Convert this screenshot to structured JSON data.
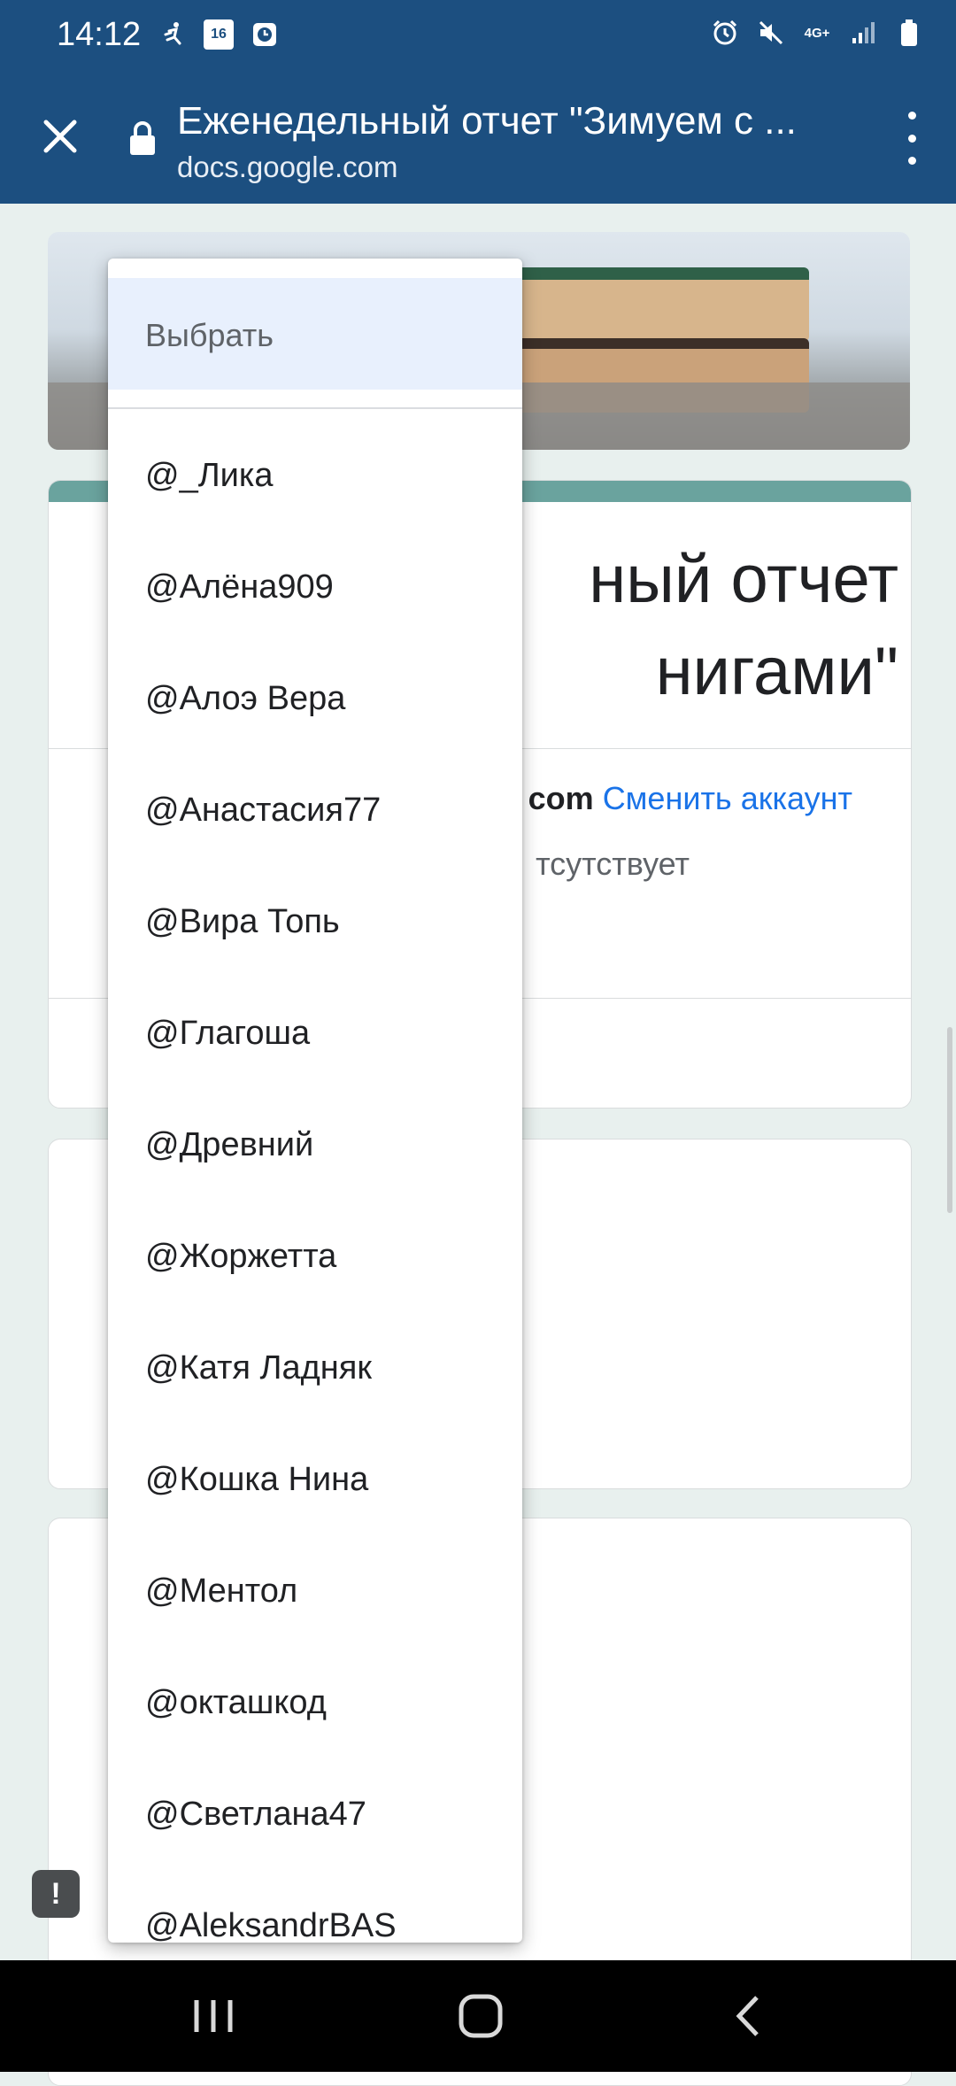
{
  "status_bar": {
    "time": "14:12",
    "left_icons": [
      "running-icon",
      "calendar-icon",
      "clock-app-icon"
    ],
    "calendar_day": "16",
    "right_icons": [
      "alarm-icon",
      "mute-icon",
      "network-4g-icon",
      "signal-icon",
      "battery-icon"
    ],
    "network_label": "4G+"
  },
  "app_bar": {
    "title": "Еженедельный отчет \"Зимуем с ...",
    "url": "docs.google.com"
  },
  "form": {
    "title_visible_line1": "ный отчет",
    "title_visible_line2": "нигами\"",
    "account_suffix": "com",
    "switch_account": "Сменить аккаунт",
    "notice_fragment": "тсутствует"
  },
  "dropdown": {
    "selected": "Выбрать",
    "options": [
      "@_Лика",
      "@Алёна909",
      "@Алоэ Вера",
      "@Анастасия77",
      "@Вира Топь",
      "@Глагоша",
      "@Древний",
      "@Жоржетта",
      "@Катя Ладняк",
      "@Кошка Нина",
      "@Ментол",
      "@окташкод",
      "@Светлана47",
      "@AleksandrBAS"
    ]
  },
  "colors": {
    "header_bg": "#1c4f80",
    "accent_teal": "#6aa39e",
    "link_blue": "#1a73e8",
    "selected_bg": "#e8f0fd"
  },
  "feedback_icon": "!"
}
